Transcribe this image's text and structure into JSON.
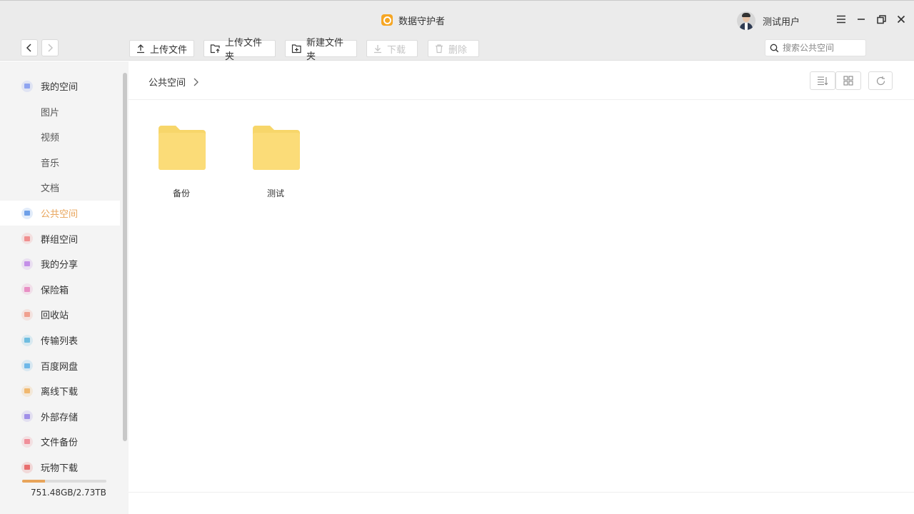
{
  "app": {
    "title": "数据守护者",
    "user_name": "测试用户"
  },
  "toolbar": {
    "upload_file": "上传文件",
    "upload_folder": "上传文件夹",
    "new_folder": "新建文件夹",
    "download": "下载",
    "delete": "删除"
  },
  "search": {
    "placeholder": "搜索公共空间"
  },
  "sidebar": {
    "items": [
      {
        "label": "我的空间",
        "icon": "my-space-icon",
        "color": "#8fa4f0",
        "sub": false,
        "active": false
      },
      {
        "label": "图片",
        "sub": true,
        "active": false
      },
      {
        "label": "视频",
        "sub": true,
        "active": false
      },
      {
        "label": "音乐",
        "sub": true,
        "active": false
      },
      {
        "label": "文档",
        "sub": true,
        "active": false
      },
      {
        "label": "公共空间",
        "icon": "public-space-icon",
        "color": "#6fa0e8",
        "sub": false,
        "active": true
      },
      {
        "label": "群组空间",
        "icon": "group-space-icon",
        "color": "#f08f8f",
        "sub": false,
        "active": false
      },
      {
        "label": "我的分享",
        "icon": "my-share-icon",
        "color": "#c48fe8",
        "sub": false,
        "active": false
      },
      {
        "label": "保险箱",
        "icon": "safe-box-icon",
        "color": "#e88fc4",
        "sub": false,
        "active": false
      },
      {
        "label": "回收站",
        "icon": "recycle-bin-icon",
        "color": "#f0a08f",
        "sub": false,
        "active": false
      },
      {
        "label": "传输列表",
        "icon": "transfer-list-icon",
        "color": "#6fbde0",
        "sub": false,
        "active": false
      },
      {
        "label": "百度网盘",
        "icon": "baidu-netdisk-icon",
        "color": "#6fb8e8",
        "sub": false,
        "active": false
      },
      {
        "label": "离线下载",
        "icon": "offline-download-icon",
        "color": "#f0b86f",
        "sub": false,
        "active": false
      },
      {
        "label": "外部存储",
        "icon": "external-storage-icon",
        "color": "#a08fe8",
        "sub": false,
        "active": false
      },
      {
        "label": "文件备份",
        "icon": "file-backup-icon",
        "color": "#f08f9a",
        "sub": false,
        "active": false
      },
      {
        "label": "玩物下载",
        "icon": "wanwu-download-icon",
        "color": "#e86f6f",
        "sub": false,
        "active": false
      }
    ],
    "storage": {
      "text": "751.48GB/2.73TB",
      "used_fraction": 0.27
    }
  },
  "main": {
    "breadcrumb": [
      "公共空间"
    ],
    "folders": [
      {
        "name": "备份"
      },
      {
        "name": "测试"
      }
    ]
  },
  "colors": {
    "accent": "#e8a45a",
    "folder": "#fbdc78",
    "folder_tab": "#f7d66a"
  }
}
